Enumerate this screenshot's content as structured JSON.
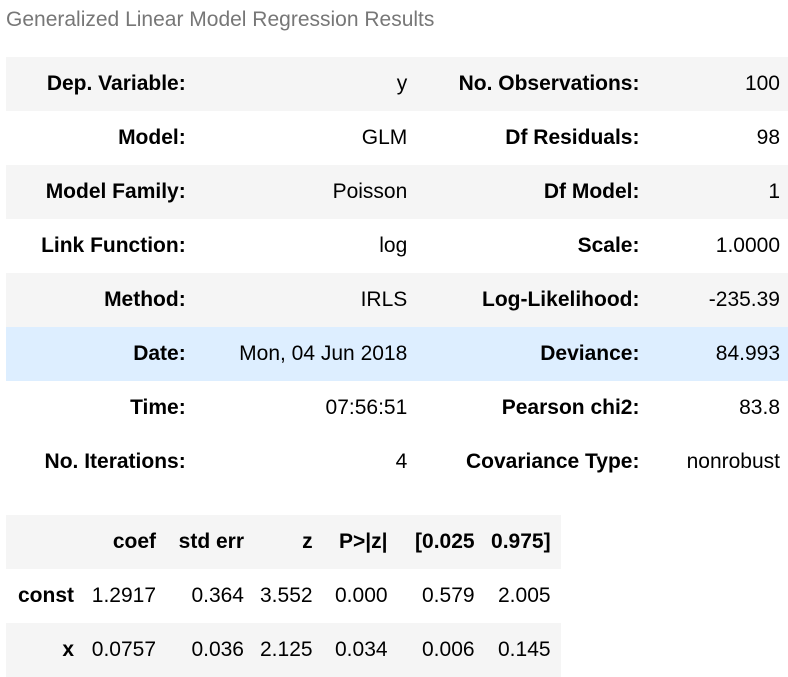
{
  "caption": "Generalized Linear Model Regression Results",
  "summary": {
    "rows": [
      {
        "label1": "Dep. Variable:",
        "value1": "y",
        "label2": "No. Observations:",
        "value2": "100"
      },
      {
        "label1": "Model:",
        "value1": "GLM",
        "label2": "Df Residuals:",
        "value2": "98"
      },
      {
        "label1": "Model Family:",
        "value1": "Poisson",
        "label2": "Df Model:",
        "value2": "1"
      },
      {
        "label1": "Link Function:",
        "value1": "log",
        "label2": "Scale:",
        "value2": "1.0000"
      },
      {
        "label1": "Method:",
        "value1": "IRLS",
        "label2": "Log-Likelihood:",
        "value2": "-235.39"
      },
      {
        "label1": "Date:",
        "value1": "Mon, 04 Jun 2018",
        "label2": "Deviance:",
        "value2": "84.993"
      },
      {
        "label1": "Time:",
        "value1": "07:56:51",
        "label2": "Pearson chi2:",
        "value2": "83.8"
      },
      {
        "label1": "No. Iterations:",
        "value1": "4",
        "label2": "Covariance Type:",
        "value2": "nonrobust"
      }
    ]
  },
  "coefficients": {
    "headers": [
      "",
      "coef",
      "std err",
      "z",
      "P>|z|",
      "[0.025",
      "0.975]"
    ],
    "rows": [
      {
        "name": "const",
        "cells": [
          "1.2917",
          "0.364",
          "3.552",
          "0.000",
          "0.579",
          "2.005"
        ]
      },
      {
        "name": "x",
        "cells": [
          "0.0757",
          "0.036",
          "2.125",
          "0.034",
          "0.006",
          "0.145"
        ]
      }
    ]
  }
}
